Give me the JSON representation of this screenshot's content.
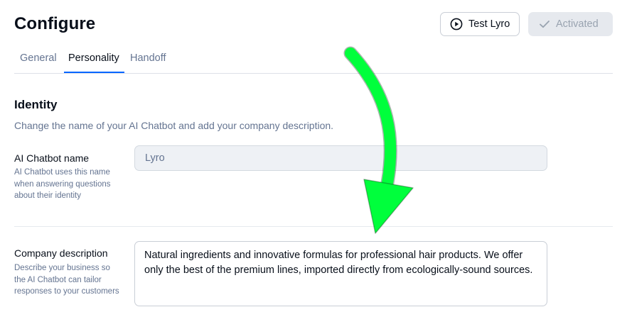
{
  "header": {
    "title": "Configure",
    "test_button_label": "Test Lyro",
    "activated_button_label": "Activated"
  },
  "tabs": [
    {
      "label": "General",
      "active": false
    },
    {
      "label": "Personality",
      "active": true
    },
    {
      "label": "Handoff",
      "active": false
    }
  ],
  "identity": {
    "title": "Identity",
    "description": "Change the name of your AI Chatbot and add your company description.",
    "name_field": {
      "label": "AI Chatbot name",
      "help": "AI Chatbot uses this name when answering questions about their identity",
      "value": "Lyro"
    },
    "company_field": {
      "label": "Company description",
      "help": "Describe your business so the AI Chatbot can tailor responses to your customers",
      "value": "Natural ingredients and innovative formulas for professional hair products. We offer only the best of the premium lines, imported directly from ecologically-sound sources."
    }
  },
  "colors": {
    "accent": "#0566ff",
    "annotation_arrow": "#00ff3c"
  },
  "icons": {
    "test_button": "play-circle-icon",
    "activated_button": "check-icon"
  }
}
